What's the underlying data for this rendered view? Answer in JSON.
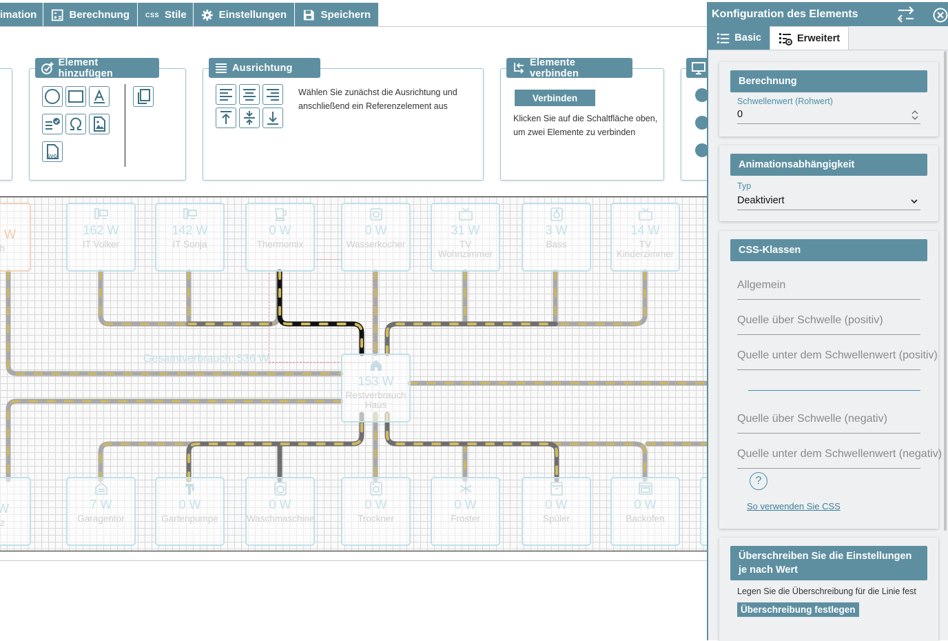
{
  "toolbar": {
    "items": [
      {
        "label": "imation",
        "icon": "none"
      },
      {
        "label": "Berechnung",
        "icon": "calculator-icon"
      },
      {
        "label": "Stile",
        "icon": "css-icon",
        "icon_text": "CSS"
      },
      {
        "label": "Einstellungen",
        "icon": "gear-icon"
      },
      {
        "label": "Speichern",
        "icon": "save-icon"
      }
    ]
  },
  "ribbon": {
    "add_element": {
      "title": "Element hinzufügen"
    },
    "alignment": {
      "title": "Ausrichtung",
      "description": "Wählen Sie zunächst die Ausrichtung und anschließend ein Referenzelement aus"
    },
    "connect": {
      "title": "Elemente verbinden",
      "button": "Verbinden",
      "description": "Klicken Sie auf die Schaltfläche oben, um zwei Elemente zu verbinden"
    },
    "tool_svg_label": "SVG"
  },
  "canvas": {
    "total_label": "Gesamtverbrauch: 536 W",
    "top_devices": [
      {
        "value": "162 W",
        "name": "IT Volker"
      },
      {
        "value": "142 W",
        "name": "IT Sonja"
      },
      {
        "value": "0 W",
        "name": "Thermomix"
      },
      {
        "value": "0 W",
        "name": "Wasserkocher"
      },
      {
        "value": "31 W",
        "name": "TV Wohnzimmer"
      },
      {
        "value": "3 W",
        "name": "Bass"
      },
      {
        "value": "14 W",
        "name": "TV Kinderzimmer"
      }
    ],
    "center_device": {
      "value": "153 W",
      "name": "Restverbrauch Haus"
    },
    "bottom_devices": [
      {
        "value": "7 W",
        "name": "Garagentor"
      },
      {
        "value": "0 W",
        "name": "Gartenpumpe"
      },
      {
        "value": "0 W",
        "name": "Waschmaschine"
      },
      {
        "value": "0 W",
        "name": "Trockner"
      },
      {
        "value": "0 W",
        "name": "Froster"
      },
      {
        "value": "0 W",
        "name": "Spüler"
      },
      {
        "value": "0 W",
        "name": "Backofen"
      }
    ],
    "partial_left_top": {
      "value": "W",
      "name": "h"
    },
    "partial_left_bottom": {
      "value": "W",
      "name": "z"
    }
  },
  "panel": {
    "title": "Konfiguration des Elements",
    "tabs": {
      "basic": "Basic",
      "advanced": "Erweitert"
    },
    "calc": {
      "title": "Berechnung",
      "threshold_label": "Schwellenwert (Rohwert)",
      "threshold_value": "0"
    },
    "anim": {
      "title": "Animationsabhängigkeit",
      "type_label": "Typ",
      "type_value": "Deaktiviert"
    },
    "css": {
      "title": "CSS-Klassen",
      "fields": [
        "Allgemein",
        "Quelle über Schwelle (positiv)",
        "Quelle unter dem Schwellenwert (positiv)",
        "",
        "Quelle über Schwelle (negativ)",
        "Quelle unter dem Schwellenwert (negativ)"
      ],
      "help_glyph": "?",
      "link": "So verwenden Sie CSS"
    },
    "override": {
      "title": "Überschreiben Sie die Einstellungen je nach Wert",
      "description": "Legen Sie die Überschreibung für die Linie fest",
      "button": "Überschreibung festlegen"
    }
  },
  "colors": {
    "accent": "#5e8fa1",
    "link": "#4a8ea8",
    "flow_gray": "#a8a8a8",
    "flow_dash": "#c8b86e"
  }
}
